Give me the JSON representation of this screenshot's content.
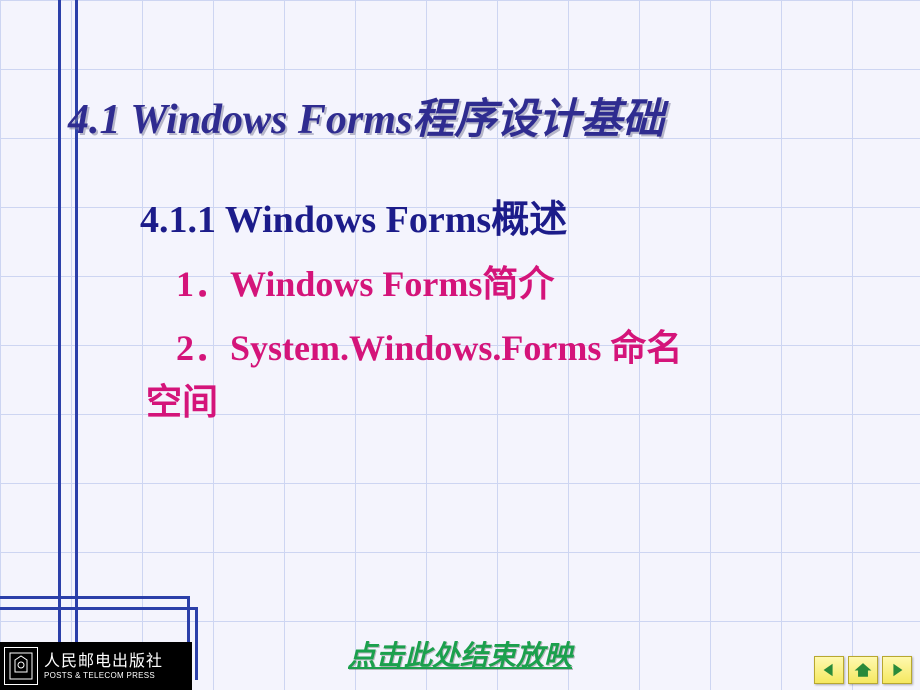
{
  "slide": {
    "title": "4.1 Windows Forms程序设计基础",
    "subtitle": "4.1.1 Windows Forms概述",
    "items": {
      "one": "1．Windows Forms简介",
      "two_a": "2．System.Windows.Forms 命名",
      "two_b": "空间"
    }
  },
  "footer": {
    "publisher_cn": "人民邮电出版社",
    "publisher_en": "POSTS & TELECOM PRESS",
    "end_link": "点击此处结束放映"
  },
  "nav": {
    "prev": "previous",
    "home": "home",
    "next": "next"
  }
}
